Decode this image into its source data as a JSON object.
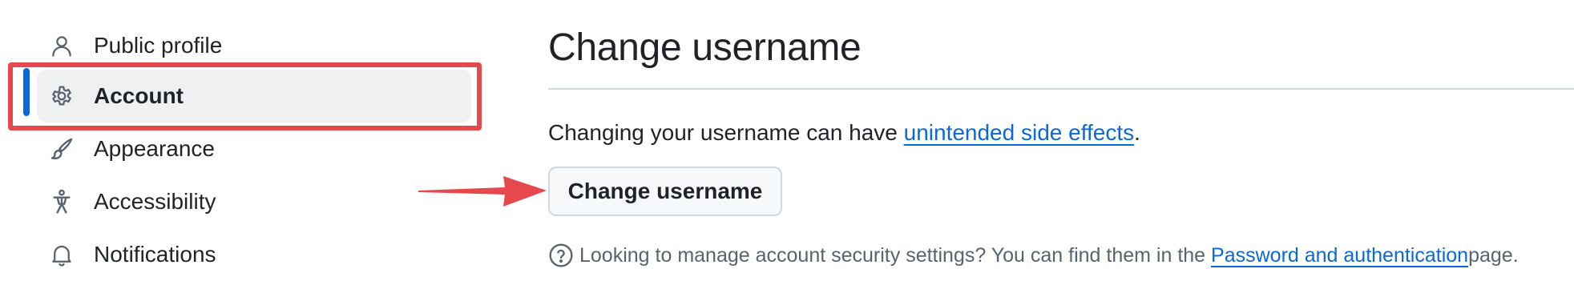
{
  "sidebar": {
    "items": [
      {
        "label": "Public profile",
        "icon": "person-icon",
        "active": false
      },
      {
        "label": "Account",
        "icon": "gear-icon",
        "active": true
      },
      {
        "label": "Appearance",
        "icon": "paintbrush-icon",
        "active": false
      },
      {
        "label": "Accessibility",
        "icon": "accessibility-icon",
        "active": false
      },
      {
        "label": "Notifications",
        "icon": "bell-icon",
        "active": false
      }
    ]
  },
  "main": {
    "title": "Change username",
    "description_prefix": "Changing your username can have ",
    "description_link": "unintended side effects",
    "description_suffix": ".",
    "button_label": "Change username",
    "note_prefix": "Looking to manage account security settings? You can find them in the ",
    "note_link": "Password and authentication",
    "note_suffix": " page."
  },
  "annotations": {
    "highlight_color": "#e5484d",
    "arrow_color": "#e5484d",
    "accent": "#0969da"
  }
}
